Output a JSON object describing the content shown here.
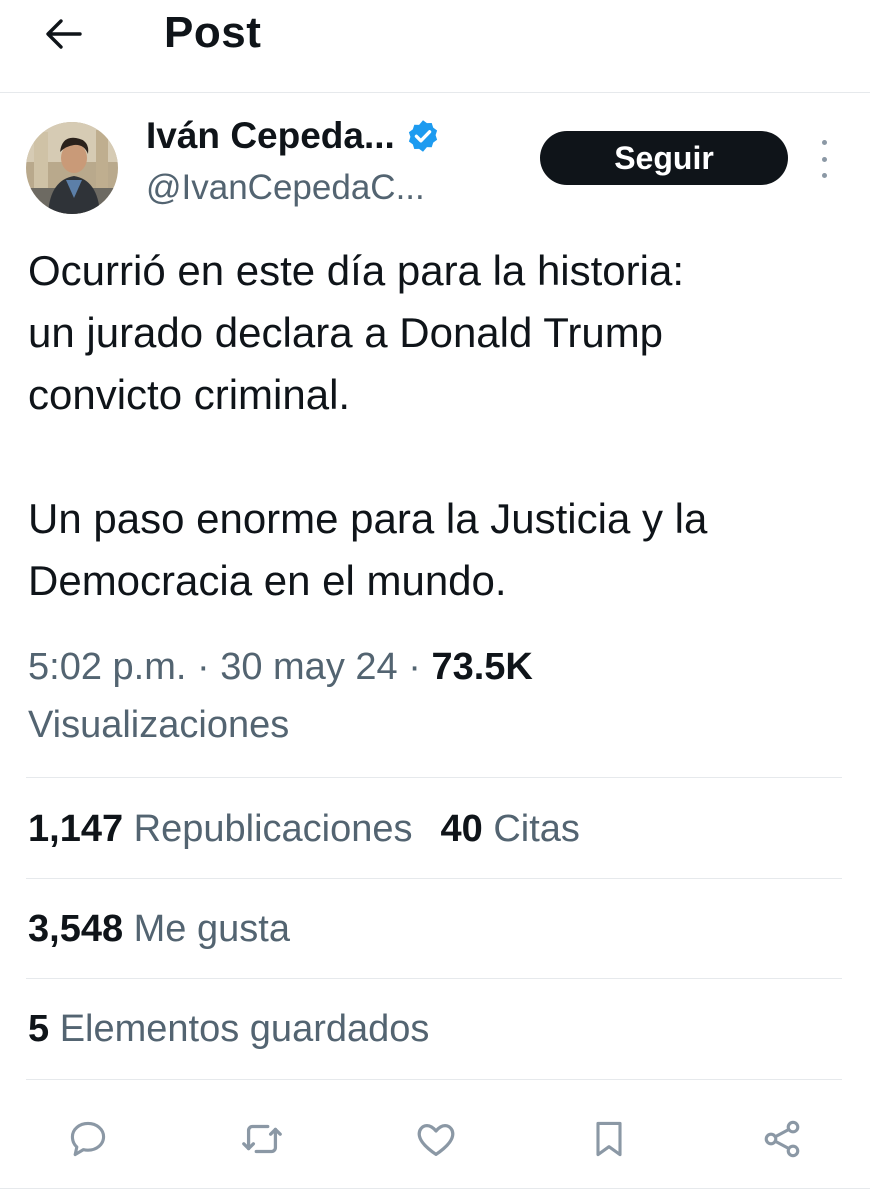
{
  "header": {
    "title": "Post"
  },
  "author": {
    "name": "Iván Cepeda...",
    "handle": "@IvanCepedaC...",
    "follow_label": "Seguir"
  },
  "tweet": {
    "line1": "Ocurrió en este día para la historia:",
    "line2": "un jurado declara a Donald Trump",
    "line3": "convicto criminal.",
    "line4": "Un paso enorme para la Justicia y la",
    "line5": "Democracia en el mundo."
  },
  "meta": {
    "time": "5:02 p.m.",
    "separator": "·",
    "date": "30 may 24",
    "views_count": "73.5K",
    "views_label": "Visualizaciones"
  },
  "stats": {
    "reposts_count": "1,147",
    "reposts_label": "Republicaciones",
    "quotes_count": "40",
    "quotes_label": "Citas",
    "likes_count": "3,548",
    "likes_label": "Me gusta",
    "saves_count": "5",
    "saves_label": "Elementos guardados"
  },
  "icons": {
    "back": "arrow-left-icon",
    "verified": "verified-badge-icon",
    "more": "more-vertical-icon",
    "reply": "reply-icon",
    "repost": "repost-icon",
    "like": "like-icon",
    "bookmark": "bookmark-icon",
    "share": "share-icon"
  },
  "colors": {
    "text": "#0f1419",
    "secondary": "#536471",
    "verified": "#1d9bf0",
    "follow_bg": "#0f1419",
    "divider": "#e6e9ec",
    "action_icon": "#8b98a5"
  }
}
